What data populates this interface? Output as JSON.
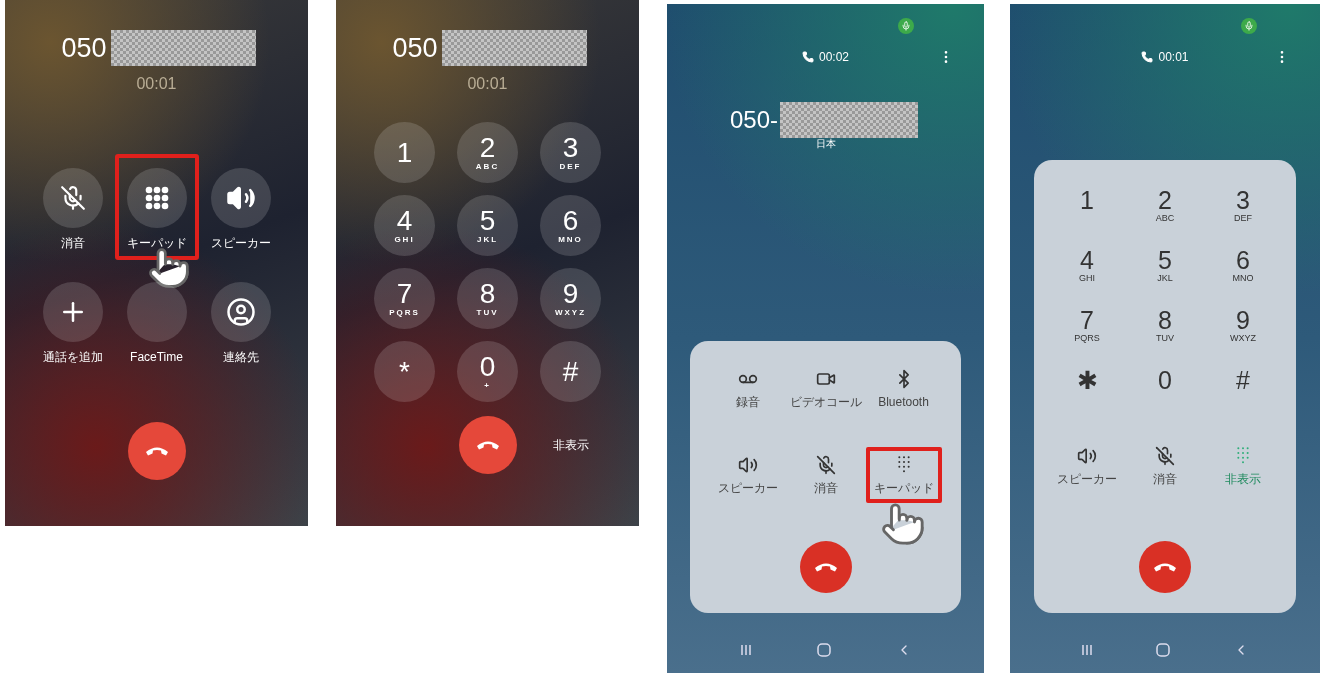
{
  "screens": [
    {
      "kind": "ios_call",
      "number": "050",
      "timer": "00:01",
      "buttons": [
        {
          "kind": "mute",
          "label": "消音",
          "highlighted": false
        },
        {
          "kind": "keypad",
          "label": "キーパッド",
          "highlighted": true
        },
        {
          "kind": "speaker",
          "label": "スピーカー",
          "highlighted": false
        },
        {
          "kind": "add",
          "label": "通話を追加",
          "highlighted": false
        },
        {
          "kind": "facetime",
          "label": "FaceTime",
          "highlighted": false
        },
        {
          "kind": "contacts",
          "label": "連絡先",
          "highlighted": false
        }
      ]
    },
    {
      "kind": "ios_keypad",
      "number": "050",
      "timer": "00:01",
      "keys": [
        {
          "digit": "1"
        },
        {
          "digit": "2",
          "letters": "ABC"
        },
        {
          "digit": "3",
          "letters": "DEF"
        },
        {
          "digit": "4",
          "letters": "GHI"
        },
        {
          "digit": "5",
          "letters": "JKL"
        },
        {
          "digit": "6",
          "letters": "MNO"
        },
        {
          "digit": "7",
          "letters": "PQRS"
        },
        {
          "digit": "8",
          "letters": "TUV"
        },
        {
          "digit": "9",
          "letters": "WXYZ"
        },
        {
          "digit": "*"
        },
        {
          "digit": "0",
          "letters": "+"
        },
        {
          "digit": "#"
        }
      ],
      "hide_label": "非表示"
    },
    {
      "kind": "android_call",
      "timer": "00:02",
      "number": "050-",
      "region": "日本",
      "buttons": [
        {
          "kind": "record",
          "label": "録音",
          "highlighted": false,
          "active": false
        },
        {
          "kind": "video",
          "label": "ビデオコール",
          "highlighted": false,
          "active": false
        },
        {
          "kind": "bluetooth",
          "label": "Bluetooth",
          "highlighted": false,
          "active": false
        },
        {
          "kind": "speaker",
          "label": "スピーカー",
          "highlighted": false,
          "active": false
        },
        {
          "kind": "mute",
          "label": "消音",
          "highlighted": false,
          "active": false
        },
        {
          "kind": "keypad",
          "label": "キーパッド",
          "highlighted": true,
          "active": false
        }
      ]
    },
    {
      "kind": "android_keypad",
      "timer": "00:01",
      "keys": [
        {
          "digit": "1"
        },
        {
          "digit": "2",
          "letters": "ABC"
        },
        {
          "digit": "3",
          "letters": "DEF"
        },
        {
          "digit": "4",
          "letters": "GHI"
        },
        {
          "digit": "5",
          "letters": "JKL"
        },
        {
          "digit": "6",
          "letters": "MNO"
        },
        {
          "digit": "7",
          "letters": "PQRS"
        },
        {
          "digit": "8",
          "letters": "TUV"
        },
        {
          "digit": "9",
          "letters": "WXYZ"
        },
        {
          "digit": "✱"
        },
        {
          "digit": "0"
        },
        {
          "digit": "#"
        }
      ],
      "buttons": [
        {
          "kind": "speaker",
          "label": "スピーカー",
          "active": false
        },
        {
          "kind": "mute",
          "label": "消音",
          "active": false
        },
        {
          "kind": "keypad",
          "label": "非表示",
          "active": true
        }
      ]
    }
  ]
}
